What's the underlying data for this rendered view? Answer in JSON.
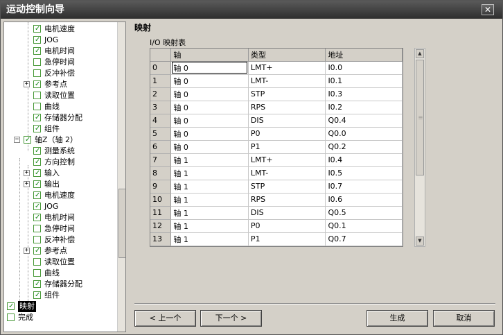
{
  "window": {
    "title": "运动控制向导",
    "close_glyph": "✕"
  },
  "tree": {
    "items": [
      {
        "label": "电机速度",
        "checked": true
      },
      {
        "label": "JOG",
        "checked": true
      },
      {
        "label": "电机时间",
        "checked": true
      },
      {
        "label": "急停时间",
        "checked": false
      },
      {
        "label": "反冲补偿",
        "checked": false
      },
      {
        "label": "参考点",
        "checked": true,
        "expander": "+"
      },
      {
        "label": "读取位置",
        "checked": false
      },
      {
        "label": "曲线",
        "checked": false
      },
      {
        "label": "存储器分配",
        "checked": true
      },
      {
        "label": "组件",
        "checked": true
      },
      {
        "label": "轴Z（轴 2）",
        "checked": true,
        "expander": "−"
      },
      {
        "label": "测量系统",
        "checked": true
      },
      {
        "label": "方向控制",
        "checked": true
      },
      {
        "label": "输入",
        "checked": true,
        "expander": "+"
      },
      {
        "label": "输出",
        "checked": true,
        "expander": "+"
      },
      {
        "label": "电机速度",
        "checked": true
      },
      {
        "label": "JOG",
        "checked": true
      },
      {
        "label": "电机时间",
        "checked": true
      },
      {
        "label": "急停时间",
        "checked": false
      },
      {
        "label": "反冲补偿",
        "checked": false
      },
      {
        "label": "参考点",
        "checked": true,
        "expander": "+"
      },
      {
        "label": "读取位置",
        "checked": false
      },
      {
        "label": "曲线",
        "checked": false
      },
      {
        "label": "存储器分配",
        "checked": true
      },
      {
        "label": "组件",
        "checked": true
      },
      {
        "label": "映射",
        "checked": true,
        "selected": true
      },
      {
        "label": "完成",
        "checked": false
      }
    ]
  },
  "panel": {
    "title": "映射",
    "table_label": "I/O 映射表",
    "columns": [
      "轴",
      "类型",
      "地址"
    ],
    "rows": [
      {
        "n": "0",
        "axis": "轴 0",
        "type": "LMT+",
        "addr": "I0.0"
      },
      {
        "n": "1",
        "axis": "轴 0",
        "type": "LMT-",
        "addr": "I0.1"
      },
      {
        "n": "2",
        "axis": "轴 0",
        "type": "STP",
        "addr": "I0.3"
      },
      {
        "n": "3",
        "axis": "轴 0",
        "type": "RPS",
        "addr": "I0.2"
      },
      {
        "n": "4",
        "axis": "轴 0",
        "type": "DIS",
        "addr": "Q0.4"
      },
      {
        "n": "5",
        "axis": "轴 0",
        "type": "P0",
        "addr": "Q0.0"
      },
      {
        "n": "6",
        "axis": "轴 0",
        "type": "P1",
        "addr": "Q0.2"
      },
      {
        "n": "7",
        "axis": "轴 1",
        "type": "LMT+",
        "addr": "I0.4"
      },
      {
        "n": "8",
        "axis": "轴 1",
        "type": "LMT-",
        "addr": "I0.5"
      },
      {
        "n": "9",
        "axis": "轴 1",
        "type": "STP",
        "addr": "I0.7"
      },
      {
        "n": "10",
        "axis": "轴 1",
        "type": "RPS",
        "addr": "I0.6"
      },
      {
        "n": "11",
        "axis": "轴 1",
        "type": "DIS",
        "addr": "Q0.5"
      },
      {
        "n": "12",
        "axis": "轴 1",
        "type": "P0",
        "addr": "Q0.1"
      },
      {
        "n": "13",
        "axis": "轴 1",
        "type": "P1",
        "addr": "Q0.7"
      }
    ]
  },
  "buttons": {
    "prev": "< 上一个",
    "next": "下一个 >",
    "generate": "生成",
    "cancel": "取消"
  }
}
